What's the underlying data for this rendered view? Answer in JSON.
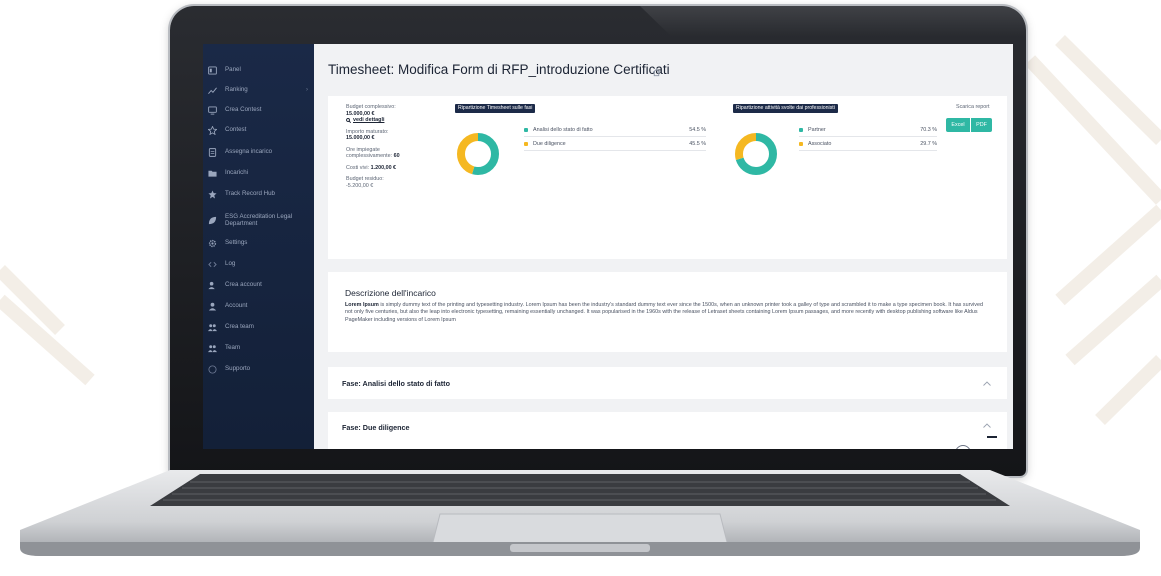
{
  "sidebar": {
    "items": [
      {
        "label": "Panel",
        "icon": "panel-icon"
      },
      {
        "label": "Ranking",
        "icon": "chart-icon",
        "chevron": "›"
      },
      {
        "label": "Crea Contest",
        "icon": "monitor-icon"
      },
      {
        "label": "Contest",
        "icon": "badge-icon"
      },
      {
        "label": "Assegna incarico",
        "icon": "document-icon"
      },
      {
        "label": "Incarichi",
        "icon": "folder-icon"
      },
      {
        "label": "Track Record Hub",
        "icon": "star-icon"
      },
      {
        "label": "ESG Accreditation Legal Department",
        "icon": "leaf-icon"
      },
      {
        "label": "Settings",
        "icon": "gear-icon"
      },
      {
        "label": "Log",
        "icon": "code-icon"
      },
      {
        "label": "Crea account",
        "icon": "user-plus-icon"
      },
      {
        "label": "Account",
        "icon": "user-icon"
      },
      {
        "label": "Crea team",
        "icon": "team-plus-icon"
      },
      {
        "label": "Team",
        "icon": "team-icon"
      },
      {
        "label": "Supporto",
        "icon": "help-icon"
      }
    ]
  },
  "header": {
    "title": "Timesheet: Modifica Form di RFP_introduzione Certificati"
  },
  "summary": {
    "budget_label": "Budget complessivo:",
    "budget_value": "15.000,00 €",
    "details_link": "vedi dettagli",
    "accrued_label": "Importo maturato:",
    "accrued_value": "15.000,00 €",
    "hours_label_1": "Ore impiegate",
    "hours_label_2": "complessivamente:",
    "hours_value": "60",
    "costs_label": "Costi vivi:",
    "costs_value": "1.200,00 €",
    "residual_label": "Budget residuo:",
    "residual_value": "-5.200,00 €"
  },
  "phases_chart": {
    "title": "Ripartizione Timesheet sulle fasi",
    "items": [
      {
        "label": "Analisi dello stato di fatto",
        "value": "54.5 %",
        "pct": 54.5,
        "color": "#2fb8a4"
      },
      {
        "label": "Due diligence",
        "value": "45.5 %",
        "pct": 45.5,
        "color": "#f5b821"
      }
    ]
  },
  "professionals_chart": {
    "title": "Ripartizione attività svolte dai professionisti",
    "items": [
      {
        "label": "Partner",
        "value": "70.3 %",
        "pct": 70.3,
        "color": "#2fb8a4"
      },
      {
        "label": "Associato",
        "value": "29.7 %",
        "pct": 29.7,
        "color": "#f5b821"
      }
    ]
  },
  "report": {
    "label": "Scarica report",
    "excel": "Excel",
    "pdf": "PDF"
  },
  "description": {
    "title": "Descrizione dell'incarico",
    "lead": "Lorem Ipsum",
    "text": " is simply dummy text of the printing and typesetting industry. Lorem Ipsum has been the industry's standard dummy text ever since the 1500s, when an unknown printer took a galley of type and scrambled it to make a type specimen book. It has survived not only five centuries, but also the leap into electronic typesetting, remaining essentially unchanged. It was popularised in the 1960s with the release of Letraset sheets containing Lorem Ipsum passages, and more recently with desktop publishing software like Aldus PageMaker including versions of Lorem Ipsum"
  },
  "phases": [
    {
      "title": "Fase: Analisi dello stato di fatto"
    },
    {
      "title": "Fase: Due diligence"
    }
  ],
  "colors": {
    "sidebar": "#1a2947",
    "accent": "#2fb8a4",
    "secondary": "#f5b821",
    "dark": "#1c2a48"
  }
}
